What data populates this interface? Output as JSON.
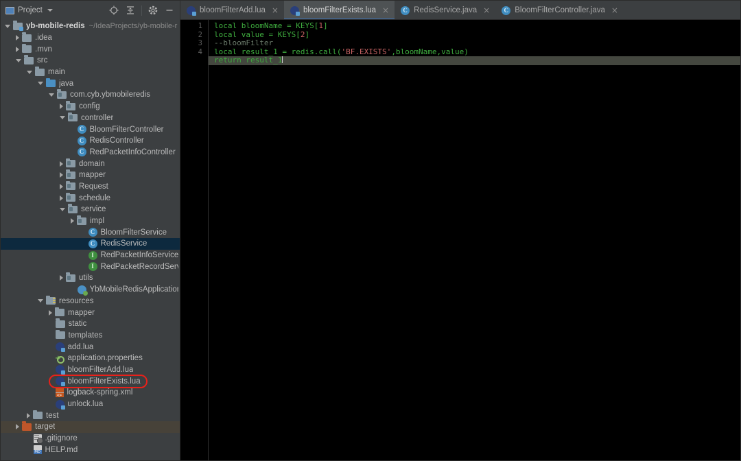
{
  "panel": {
    "title": "Project",
    "dropdown_icon": "chevron-down-icon",
    "tools": [
      {
        "name": "locate-icon",
        "title": "Select Opened File"
      },
      {
        "name": "collapse-all-icon",
        "title": "Collapse All"
      },
      {
        "name": "gear-icon",
        "title": "Settings"
      },
      {
        "name": "minimize-icon",
        "title": "Hide"
      }
    ]
  },
  "tabs": [
    {
      "label": "bloomFilterAdd.lua",
      "icon": "lua-file-icon",
      "active": false,
      "close": "×"
    },
    {
      "label": "bloomFilterExists.lua",
      "icon": "lua-file-icon",
      "active": true,
      "close": "×"
    },
    {
      "label": "RedisService.java",
      "icon": "java-class-icon",
      "active": false,
      "close": "×"
    },
    {
      "label": "BloomFilterController.java",
      "icon": "java-class-icon",
      "active": false,
      "close": "×"
    }
  ],
  "tree": [
    {
      "label": "yb-mobile-redis",
      "sub": "~/IdeaProjects/yb-mobile-r",
      "depth": 0,
      "arrow": "open",
      "icon": "module-folder-icon",
      "bold": true,
      "state": "normal"
    },
    {
      "label": ".idea",
      "sub": "",
      "depth": 1,
      "arrow": "closed",
      "icon": "folder-icon",
      "bold": false,
      "state": "normal"
    },
    {
      "label": ".mvn",
      "sub": "",
      "depth": 1,
      "arrow": "closed",
      "icon": "folder-icon",
      "bold": false,
      "state": "normal"
    },
    {
      "label": "src",
      "sub": "",
      "depth": 1,
      "arrow": "open",
      "icon": "folder-icon",
      "bold": false,
      "state": "normal"
    },
    {
      "label": "main",
      "sub": "",
      "depth": 2,
      "arrow": "open",
      "icon": "folder-icon",
      "bold": false,
      "state": "normal"
    },
    {
      "label": "java",
      "sub": "",
      "depth": 3,
      "arrow": "open",
      "icon": "source-folder-icon",
      "bold": false,
      "state": "normal"
    },
    {
      "label": "com.cyb.ybmobileredis",
      "sub": "",
      "depth": 4,
      "arrow": "open",
      "icon": "package-icon",
      "bold": false,
      "state": "normal"
    },
    {
      "label": "config",
      "sub": "",
      "depth": 5,
      "arrow": "closed",
      "icon": "package-icon",
      "bold": false,
      "state": "normal"
    },
    {
      "label": "controller",
      "sub": "",
      "depth": 5,
      "arrow": "open",
      "icon": "package-icon",
      "bold": false,
      "state": "normal"
    },
    {
      "label": "BloomFilterController",
      "sub": "",
      "depth": 6,
      "arrow": "none",
      "icon": "java-class-icon",
      "bold": false,
      "state": "normal"
    },
    {
      "label": "RedisController",
      "sub": "",
      "depth": 6,
      "arrow": "none",
      "icon": "java-class-icon",
      "bold": false,
      "state": "normal"
    },
    {
      "label": "RedPacketInfoController",
      "sub": "",
      "depth": 6,
      "arrow": "none",
      "icon": "java-class-icon",
      "bold": false,
      "state": "normal"
    },
    {
      "label": "domain",
      "sub": "",
      "depth": 5,
      "arrow": "closed",
      "icon": "package-icon",
      "bold": false,
      "state": "normal"
    },
    {
      "label": "mapper",
      "sub": "",
      "depth": 5,
      "arrow": "closed",
      "icon": "package-icon",
      "bold": false,
      "state": "normal"
    },
    {
      "label": "Request",
      "sub": "",
      "depth": 5,
      "arrow": "closed",
      "icon": "package-icon",
      "bold": false,
      "state": "normal"
    },
    {
      "label": "schedule",
      "sub": "",
      "depth": 5,
      "arrow": "closed",
      "icon": "package-icon",
      "bold": false,
      "state": "normal"
    },
    {
      "label": "service",
      "sub": "",
      "depth": 5,
      "arrow": "open",
      "icon": "package-icon",
      "bold": false,
      "state": "normal"
    },
    {
      "label": "impl",
      "sub": "",
      "depth": 6,
      "arrow": "closed",
      "icon": "package-icon",
      "bold": false,
      "state": "normal"
    },
    {
      "label": "BloomFilterService",
      "sub": "",
      "depth": 7,
      "arrow": "none",
      "icon": "java-class-icon",
      "bold": false,
      "state": "normal"
    },
    {
      "label": "RedisService",
      "sub": "",
      "depth": 7,
      "arrow": "none",
      "icon": "java-class-icon",
      "bold": false,
      "state": "selected"
    },
    {
      "label": "RedPacketInfoService",
      "sub": "",
      "depth": 7,
      "arrow": "none",
      "icon": "java-interface-icon",
      "bold": false,
      "state": "normal"
    },
    {
      "label": "RedPacketRecordService",
      "sub": "",
      "depth": 7,
      "arrow": "none",
      "icon": "java-interface-icon",
      "bold": false,
      "state": "normal"
    },
    {
      "label": "utils",
      "sub": "",
      "depth": 5,
      "arrow": "closed",
      "icon": "package-icon",
      "bold": false,
      "state": "normal"
    },
    {
      "label": "YbMobileRedisApplication",
      "sub": "",
      "depth": 6,
      "arrow": "none",
      "icon": "spring-boot-icon",
      "bold": false,
      "state": "normal"
    },
    {
      "label": "resources",
      "sub": "",
      "depth": 3,
      "arrow": "open",
      "icon": "resources-folder-icon",
      "bold": false,
      "state": "normal"
    },
    {
      "label": "mapper",
      "sub": "",
      "depth": 4,
      "arrow": "closed",
      "icon": "folder-icon",
      "bold": false,
      "state": "normal"
    },
    {
      "label": "static",
      "sub": "",
      "depth": 4,
      "arrow": "none",
      "icon": "folder-icon",
      "bold": false,
      "state": "normal"
    },
    {
      "label": "templates",
      "sub": "",
      "depth": 4,
      "arrow": "none",
      "icon": "folder-icon",
      "bold": false,
      "state": "normal"
    },
    {
      "label": "add.lua",
      "sub": "",
      "depth": 4,
      "arrow": "none",
      "icon": "lua-file-icon",
      "bold": false,
      "state": "normal"
    },
    {
      "label": "application.properties",
      "sub": "",
      "depth": 4,
      "arrow": "none",
      "icon": "properties-file-icon",
      "bold": false,
      "state": "normal"
    },
    {
      "label": "bloomFilterAdd.lua",
      "sub": "",
      "depth": 4,
      "arrow": "none",
      "icon": "lua-file-icon",
      "bold": false,
      "state": "normal"
    },
    {
      "label": "bloomFilterExists.lua",
      "sub": "",
      "depth": 4,
      "arrow": "none",
      "icon": "lua-file-icon",
      "bold": false,
      "state": "annotated"
    },
    {
      "label": "logback-spring.xml",
      "sub": "",
      "depth": 4,
      "arrow": "none",
      "icon": "xml-file-icon",
      "bold": false,
      "state": "normal"
    },
    {
      "label": "unlock.lua",
      "sub": "",
      "depth": 4,
      "arrow": "none",
      "icon": "lua-file-icon",
      "bold": false,
      "state": "normal"
    },
    {
      "label": "test",
      "sub": "",
      "depth": 2,
      "arrow": "closed",
      "icon": "folder-icon",
      "bold": false,
      "state": "normal"
    },
    {
      "label": "target",
      "sub": "",
      "depth": 1,
      "arrow": "closed",
      "icon": "excluded-folder-icon",
      "bold": false,
      "state": "hovered"
    },
    {
      "label": ".gitignore",
      "sub": "",
      "depth": 2,
      "arrow": "none",
      "icon": "gitignore-file-icon",
      "bold": false,
      "state": "normal"
    },
    {
      "label": "HELP.md",
      "sub": "",
      "depth": 2,
      "arrow": "none",
      "icon": "markdown-file-icon",
      "bold": false,
      "state": "normal"
    }
  ],
  "editor": {
    "line_numbers": [
      "1",
      "2",
      "3",
      "4",
      ""
    ],
    "lines": [
      [
        {
          "t": "local",
          "c": "kw"
        },
        {
          "t": " bloomName = KEYS[",
          "c": "plain"
        },
        {
          "t": "1",
          "c": "num"
        },
        {
          "t": "]",
          "c": "plain"
        }
      ],
      [
        {
          "t": "local",
          "c": "kw"
        },
        {
          "t": " value = KEYS[",
          "c": "plain"
        },
        {
          "t": "2",
          "c": "num"
        },
        {
          "t": "]",
          "c": "plain"
        }
      ],
      [
        {
          "t": "--bloomFilter",
          "c": "cmt"
        }
      ],
      [
        {
          "t": "local",
          "c": "kw"
        },
        {
          "t": " result_1 = redis.call(",
          "c": "plain"
        },
        {
          "t": "'BF.EXISTS'",
          "c": "str"
        },
        {
          "t": ",bloomName,value)",
          "c": "plain"
        }
      ],
      [
        {
          "t": "return",
          "c": "kw"
        },
        {
          "t": " result_1",
          "c": "plain"
        }
      ]
    ],
    "caret_line": 5
  },
  "colors": {
    "panel_bg": "#3c3f41",
    "editor_bg": "#000000",
    "selection": "#0d293e",
    "hover": "#474239",
    "current_line": "#44473f",
    "accent": "#3d72b5",
    "annotation": "#e8211a",
    "keyword": "#3fae3f",
    "string": "#cc6666",
    "comment": "#6a7a6a"
  }
}
